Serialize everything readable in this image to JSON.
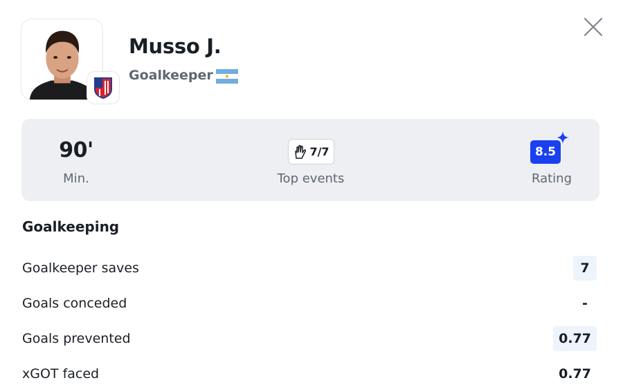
{
  "player": {
    "name": "Musso J.",
    "position": "Goalkeeper",
    "nationality_flag": "argentina-flag-icon",
    "club_badge": "atletico-madrid-badge-icon"
  },
  "summary": {
    "minutes": {
      "value": "90'",
      "label": "Min."
    },
    "top_events": {
      "value": "7/7",
      "label": "Top events",
      "icon": "goalkeeper-glove-icon"
    },
    "rating": {
      "value": "8.5",
      "label": "Rating",
      "color": "#1b40f0"
    }
  },
  "section": {
    "title": "Goalkeeping",
    "rows": [
      {
        "name": "Goalkeeper saves",
        "value": "7",
        "highlighted": true
      },
      {
        "name": "Goals conceded",
        "value": "-",
        "highlighted": false
      },
      {
        "name": "Goals prevented",
        "value": "0.77",
        "highlighted": true
      },
      {
        "name": "xGOT faced",
        "value": "0.77",
        "highlighted": false
      }
    ]
  },
  "colors": {
    "accent": "#1b40f0",
    "panel": "#edeff2",
    "highlight": "#edf4fb"
  }
}
